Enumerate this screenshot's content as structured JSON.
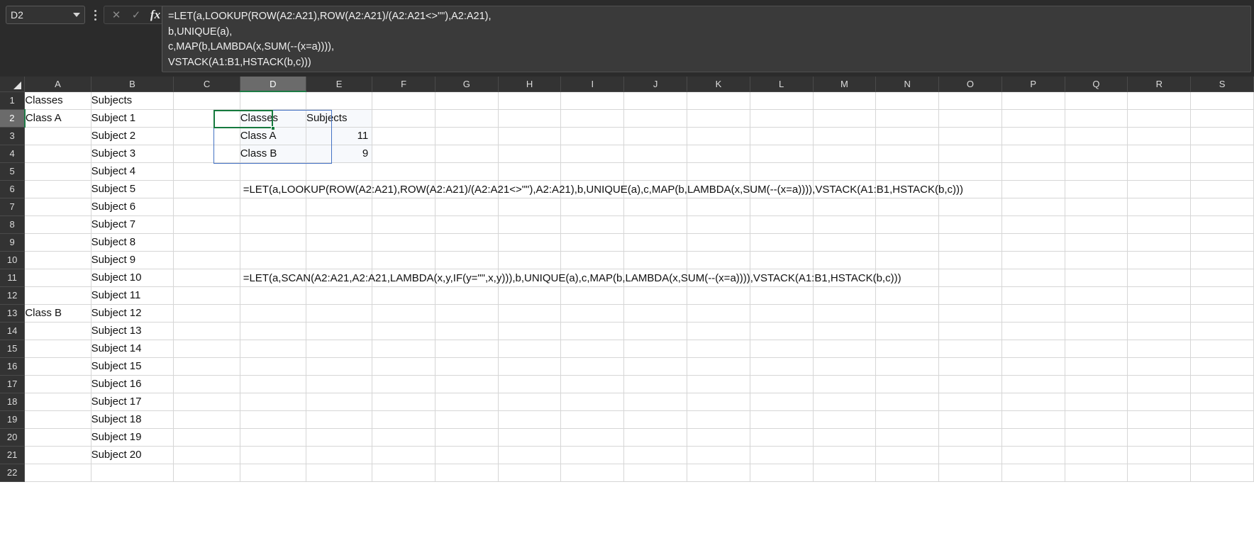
{
  "app": {
    "theme": "dark",
    "accent_green": "#167a3e",
    "spill_blue": "#4472c4"
  },
  "formula_bar": {
    "name_box_value": "D2",
    "name_box_placeholder": "Name Box",
    "cancel_icon": "close-icon",
    "enter_icon": "check-icon",
    "function_icon": "fx-icon",
    "cancel_label": "✕",
    "enter_label": "✓",
    "fx_label": "fx",
    "formula_lines": [
      "=LET(a,LOOKUP(ROW(A2:A21),ROW(A2:A21)/(A2:A21<>\"\"),A2:A21),",
      "b,UNIQUE(a),",
      "c,MAP(b,LAMBDA(x,SUM(--(x=a)))),",
      "VSTACK(A1:B1,HSTACK(b,c)))"
    ]
  },
  "grid": {
    "column_headers": [
      "A",
      "B",
      "C",
      "D",
      "E",
      "F",
      "G",
      "H",
      "I",
      "J",
      "K",
      "L",
      "M",
      "N",
      "O",
      "P",
      "Q",
      "R",
      "S"
    ],
    "active_column": "D",
    "active_row": "2",
    "active_cell": "D2",
    "row_headers": [
      "1",
      "2",
      "3",
      "4",
      "5",
      "6",
      "7",
      "8",
      "9",
      "10",
      "11",
      "12",
      "13",
      "14",
      "15",
      "16",
      "17",
      "18",
      "19",
      "20",
      "21",
      "22"
    ],
    "cells": {
      "A1": "Classes",
      "B1": "Subjects",
      "A2": "Class A",
      "B2": "Subject 1",
      "B3": "Subject 2",
      "B4": "Subject 3",
      "B5": "Subject 4",
      "B6": "Subject 5",
      "B7": "Subject 6",
      "B8": "Subject 7",
      "B9": "Subject 8",
      "B10": "Subject 9",
      "B11": "Subject 10",
      "B12": "Subject 11",
      "A13": "Class B",
      "B13": "Subject 12",
      "B14": "Subject 13",
      "B15": "Subject 14",
      "B16": "Subject 15",
      "B17": "Subject 16",
      "B18": "Subject 17",
      "B19": "Subject 18",
      "B20": "Subject 19",
      "B21": "Subject 20",
      "D2": "Classes",
      "E2": "Subjects",
      "D3": "Class A",
      "E3": "11",
      "D4": "Class B",
      "E4": "9"
    },
    "overflow_texts": {
      "D6": "=LET(a,LOOKUP(ROW(A2:A21),ROW(A2:A21)/(A2:A21<>\"\"),A2:A21),b,UNIQUE(a),c,MAP(b,LAMBDA(x,SUM(--(x=a)))),VSTACK(A1:B1,HSTACK(b,c)))",
      "D11": "=LET(a,SCAN(A2:A21,A2:A21,LAMBDA(x,y,IF(y=\"\",x,y))),b,UNIQUE(a),c,MAP(b,LAMBDA(x,SUM(--(x=a)))),VSTACK(A1:B1,HSTACK(b,c)))"
    }
  }
}
